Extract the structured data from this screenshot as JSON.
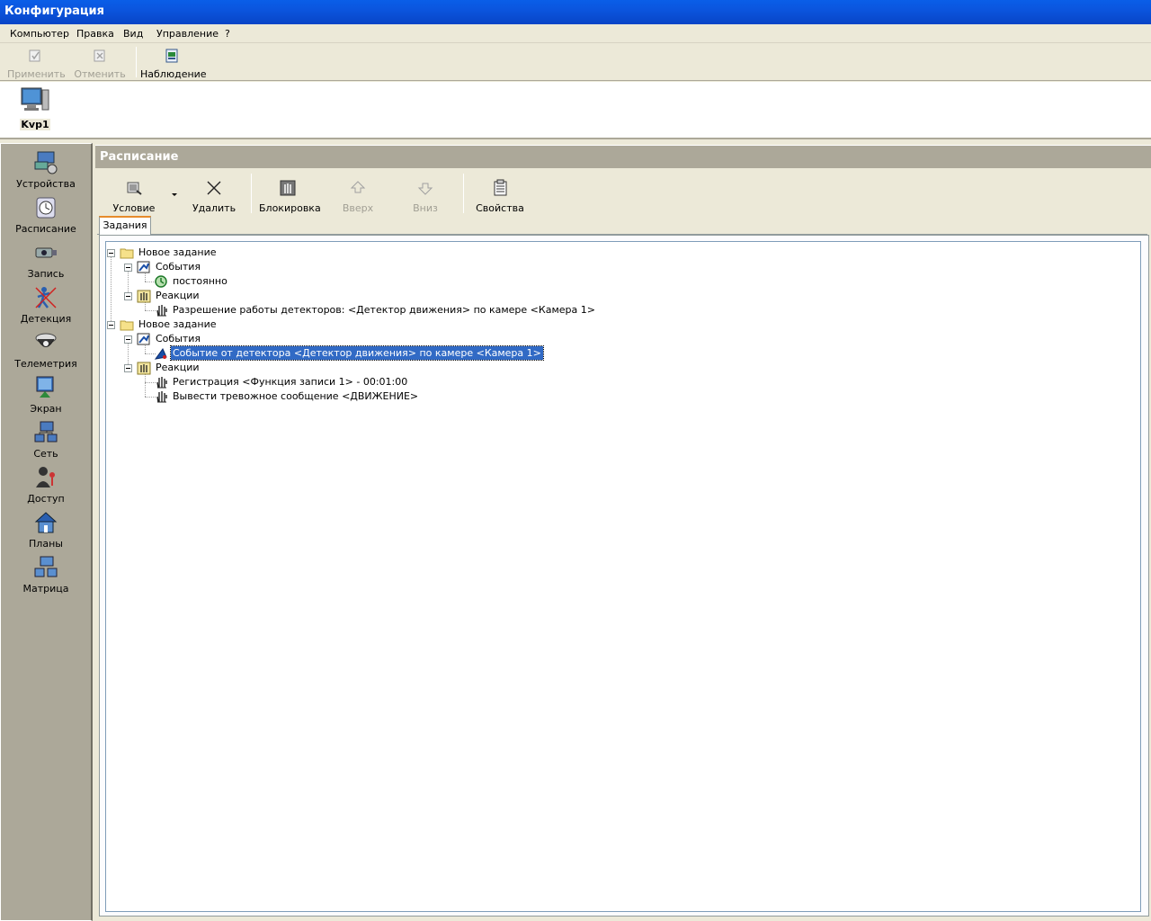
{
  "window": {
    "title": "Конфигурация"
  },
  "menu": {
    "items": [
      "Компьютер",
      "Правка",
      "Вид",
      "Управление",
      "?"
    ]
  },
  "toolbar": {
    "apply_label": "Применить",
    "cancel_label": "Отменить",
    "monitor_label": "Наблюдение"
  },
  "computer": {
    "label": "Kvp1"
  },
  "nav": {
    "items": [
      "Устройства",
      "Расписание",
      "Запись",
      "Детекция",
      "Телеметрия",
      "Экран",
      "Сеть",
      "Доступ",
      "Планы",
      "Матрица"
    ]
  },
  "panel": {
    "title": "Расписание",
    "toolbar": {
      "condition_label": "Условие",
      "delete_label": "Удалить",
      "block_label": "Блокировка",
      "up_label": "Вверх",
      "down_label": "Вниз",
      "properties_label": "Свойства"
    },
    "tab_label": "Задания"
  },
  "tree": {
    "task1": {
      "label": "Новое задание",
      "events_label": "События",
      "event1": "постоянно",
      "reactions_label": "Реакции",
      "reaction1": "Разрешение работы детекторов: <Детектор движения> по камере <Камера  1>"
    },
    "task2": {
      "label": "Новое задание",
      "events_label": "События",
      "event1": "Событие от детектора <Детектор движения> по камере <Камера  1>",
      "reactions_label": "Реакции",
      "reaction1": "Регистрация <Функция записи 1> - 00:01:00",
      "reaction2": "Вывести тревожное сообщение <ДВИЖЕНИЕ>"
    }
  },
  "colors": {
    "titlebar": "#0a5ee8",
    "selection": "#316ac5",
    "nav_bg": "#aca899"
  }
}
